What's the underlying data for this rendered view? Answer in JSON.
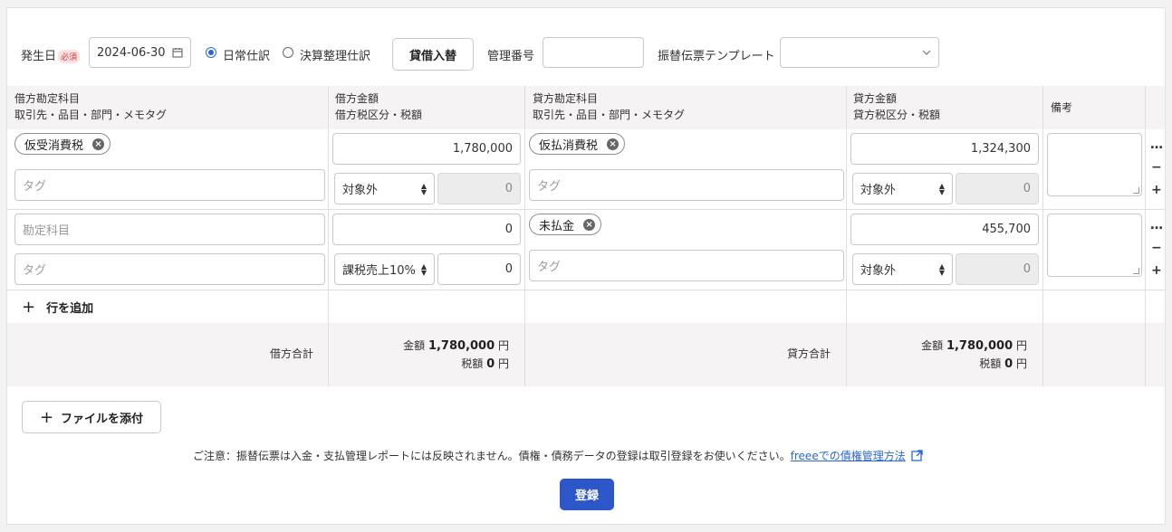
{
  "header": {
    "date_label": "発生日",
    "required_badge": "必須",
    "date_value": "2024-06-30",
    "radio_daily": "日常仕訳",
    "radio_closing": "決算整理仕訳",
    "swap_button": "貸借入替",
    "manage_no_label": "管理番号",
    "manage_no_value": "",
    "template_label": "振替伝票テンプレート",
    "template_value": ""
  },
  "columns": {
    "debit_account": "借方勘定科目",
    "debit_account_sub": "取引先・品目・部門・メモタグ",
    "debit_amount": "借方金額",
    "debit_amount_sub": "借方税区分・税額",
    "credit_account": "貸方勘定科目",
    "credit_account_sub": "取引先・品目・部門・メモタグ",
    "credit_amount": "貸方金額",
    "credit_amount_sub": "貸方税区分・税額",
    "memo": "備考"
  },
  "rows": [
    {
      "debit_account": "仮受消費税",
      "debit_tag_placeholder": "タグ",
      "debit_amount": "1,780,000",
      "debit_tax_class": "対象外",
      "debit_tax": "0",
      "credit_account": "仮払消費税",
      "credit_tag_placeholder": "タグ",
      "credit_amount": "1,324,300",
      "credit_tax_class": "対象外",
      "credit_tax": "0"
    },
    {
      "debit_account_placeholder": "勘定科目",
      "debit_tag_placeholder": "タグ",
      "debit_amount": "0",
      "debit_tax_class": "課税売上10%",
      "debit_tax": "0",
      "credit_account": "未払金",
      "credit_tag_placeholder": "タグ",
      "credit_amount": "455,700",
      "credit_tax_class": "対象外",
      "credit_tax": "0"
    }
  ],
  "row_controls": {
    "more": "…",
    "remove": "−",
    "add": "+"
  },
  "add_row": "行を追加",
  "totals": {
    "debit_label": "借方合計",
    "credit_label": "貸方合計",
    "amount_label": "金額",
    "tax_label": "税額",
    "debit_amount": "1,780,000",
    "debit_tax": "0",
    "credit_amount": "1,780,000",
    "credit_tax": "0",
    "yen": "円"
  },
  "attach_button": "ファイルを添付",
  "notice": "ご注意：振替伝票は入金・支払管理レポートには反映されません。債権・債務データの登録は取引登録をお使いください。",
  "notice_link": "freeeでの債権管理方法",
  "submit_button": "登録"
}
